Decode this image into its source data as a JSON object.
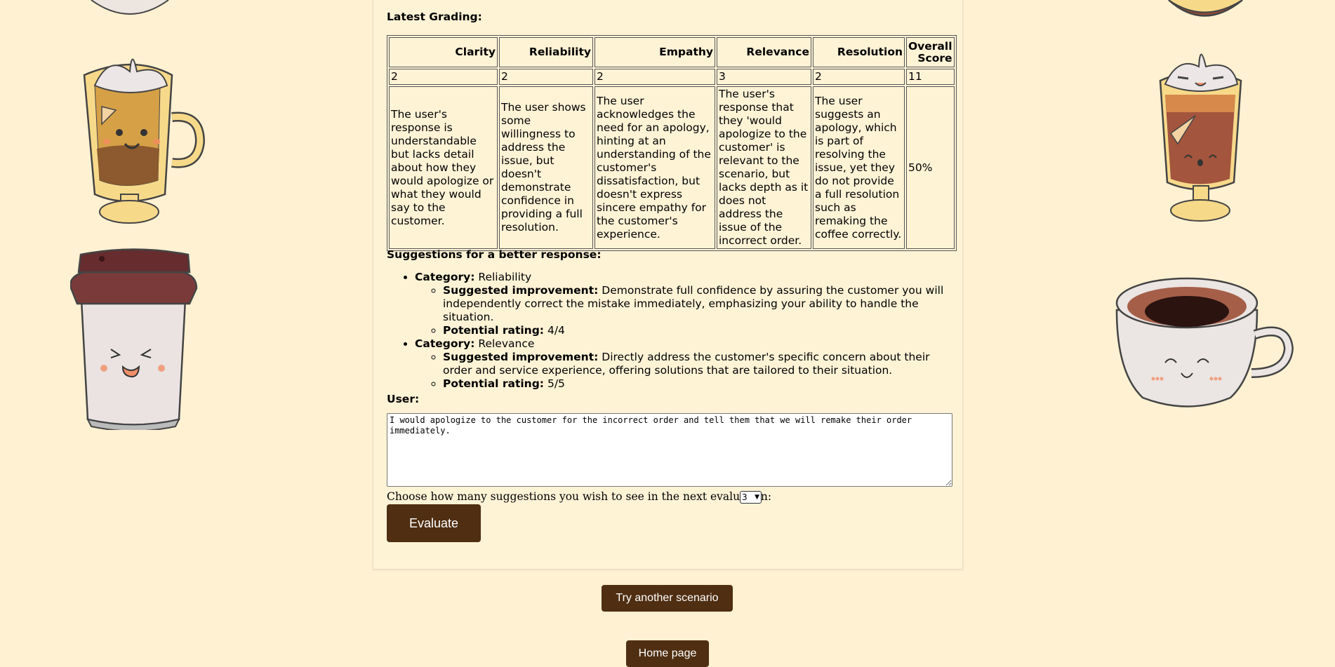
{
  "grading": {
    "heading": "Latest Grading:",
    "headers": [
      "Clarity",
      "Reliability",
      "Empathy",
      "Relevance",
      "Resolution",
      "Overall Score"
    ],
    "scores": [
      "2",
      "2",
      "2",
      "3",
      "2",
      "11"
    ],
    "explanations": [
      "The user's response is understandable but lacks detail about how they would apologize or what they would say to the customer.",
      "The user shows some willingness to address the issue, but doesn't demonstrate confidence in providing a full resolution.",
      "The user acknowledges the need for an apology, hinting at an understanding of the customer's dissatisfaction, but doesn't express sincere empathy for the customer's experience.",
      "The user's response that they 'would apologize to the customer' is relevant to the scenario, but lacks depth as it does not address the issue of the incorrect order.",
      "The user suggests an apology, which is part of resolving the issue, yet they do not provide a full resolution such as remaking the coffee correctly.",
      "50%"
    ]
  },
  "suggestions": {
    "heading": "Suggestions for a better response:",
    "category_label": "Category:",
    "improvement_label": "Suggested improvement:",
    "rating_label": "Potential rating:",
    "items": [
      {
        "category": "Reliability",
        "improvement": "Demonstrate full confidence by assuring the customer you will independently correct the mistake immediately, emphasizing your ability to handle the situation.",
        "rating": "4/4"
      },
      {
        "category": "Relevance",
        "improvement": "Directly address the customer's specific concern about their order and service experience, offering solutions that are tailored to their situation.",
        "rating": "5/5"
      }
    ]
  },
  "user": {
    "heading": "User:",
    "response": "I would apologize to the customer for the incorrect order and tell them that we will remake their order immediately."
  },
  "controls": {
    "choose_label": "Choose how many suggestions you wish to see in the next evaluation:",
    "suggestion_count": "3",
    "evaluate_label": "Evaluate",
    "try_another_label": "Try another scenario",
    "home_label": "Home page"
  },
  "colors": {
    "background": "#fff1d2",
    "button": "#4f2e12"
  }
}
